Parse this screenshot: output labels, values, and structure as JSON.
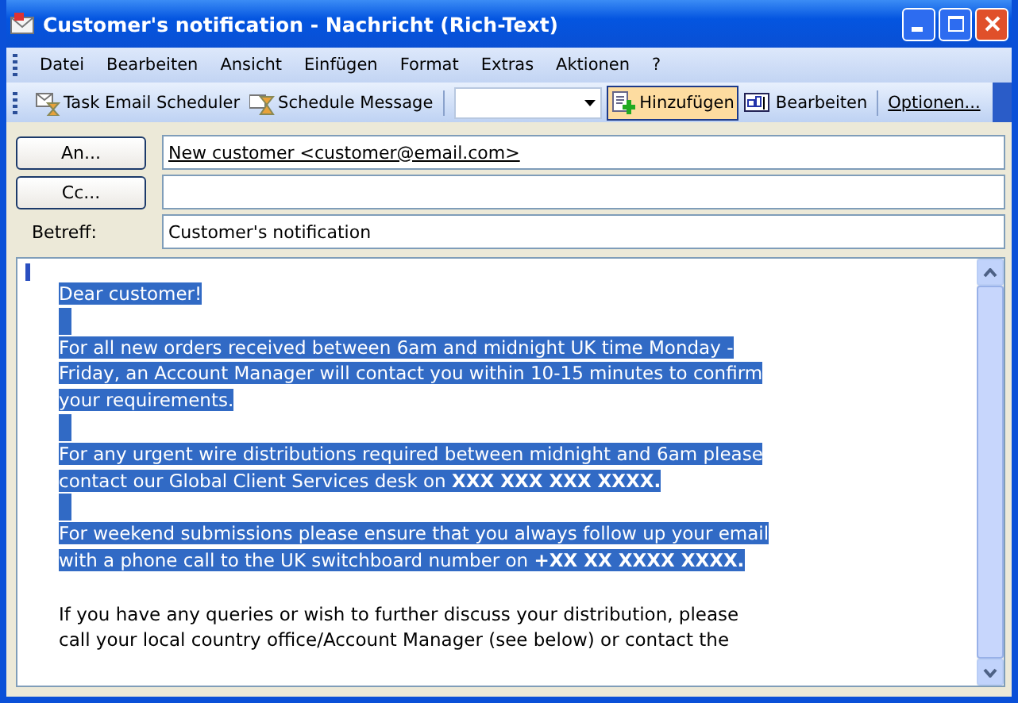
{
  "window": {
    "title": "Customer's notification - Nachricht (Rich-Text)"
  },
  "menu": [
    "Datei",
    "Bearbeiten",
    "Ansicht",
    "Einfügen",
    "Format",
    "Extras",
    "Aktionen",
    "?"
  ],
  "toolbar": [
    {
      "kind": "button",
      "label": "Task Email Scheduler",
      "pressed": false
    },
    {
      "kind": "button",
      "label": "Schedule Message",
      "pressed": false
    },
    {
      "kind": "combo"
    },
    {
      "kind": "button",
      "label": "Hinzufügen",
      "pressed": true
    },
    {
      "kind": "button",
      "label": "Bearbeiten",
      "pressed": false
    },
    {
      "kind": "button",
      "label": "Optionen...",
      "pressed": false
    }
  ],
  "header": [
    {
      "kind": "button",
      "label": "An...",
      "value": "New customer  <customer@email.com>"
    },
    {
      "kind": "button",
      "label": "Cc..."
    },
    {
      "kind": "label",
      "label": "Betreff:",
      "value": "Customer's notification"
    }
  ],
  "body": [
    {
      "lines": [
        "Dear customer!"
      ],
      "selected": true
    },
    {
      "lines": [
        "For all new orders received between 6am and midnight UK time Monday -",
        "Friday, an Account Manager will contact you within 10-15 minutes to confirm",
        "your requirements."
      ],
      "selected": true
    },
    {
      "lines": [
        "For any urgent wire distributions required between midnight and 6am please",
        "contact our Global Client Services desk on **XXX XXX XXX XXXX.**"
      ],
      "selected": true
    },
    {
      "lines": [
        "For weekend submissions please ensure that you always follow up your email",
        "with a phone call to the UK switchboard number on **+XX XX XXXX XXXX.**"
      ],
      "selected": true
    },
    {
      "lines": [
        "If you have any queries or wish to further discuss your distribution, please",
        "call your local country office/Account Manager (see below) or contact the"
      ],
      "selected": false
    }
  ]
}
